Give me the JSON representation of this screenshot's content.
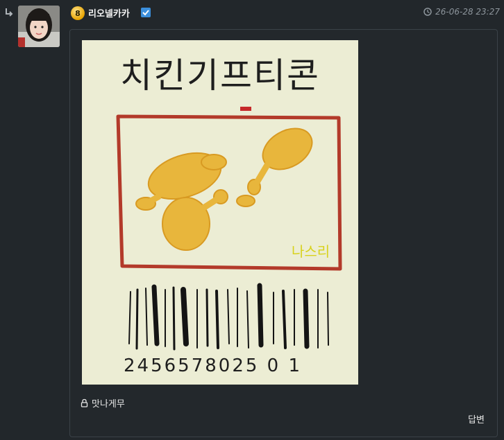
{
  "comment": {
    "level": "8",
    "username": "리오넬카카",
    "verified": true,
    "timestamp": "26-06-28 23:27",
    "caption": "맛나게무",
    "reply_label": "답변"
  },
  "image": {
    "title": "치킨기프티콘",
    "signature": "나스리",
    "barcode_number": "2456578025 0 1"
  },
  "colors": {
    "background": "#22272b",
    "card_border": "#3b4248",
    "accent_verified": "#3b8fdc",
    "level_badge": "#e7a300",
    "muted_text": "#8d959c"
  },
  "icons": {
    "reply": "reply-arrow-icon",
    "clock": "clock-icon",
    "lock": "lock-icon",
    "verified": "checkmark-icon"
  }
}
